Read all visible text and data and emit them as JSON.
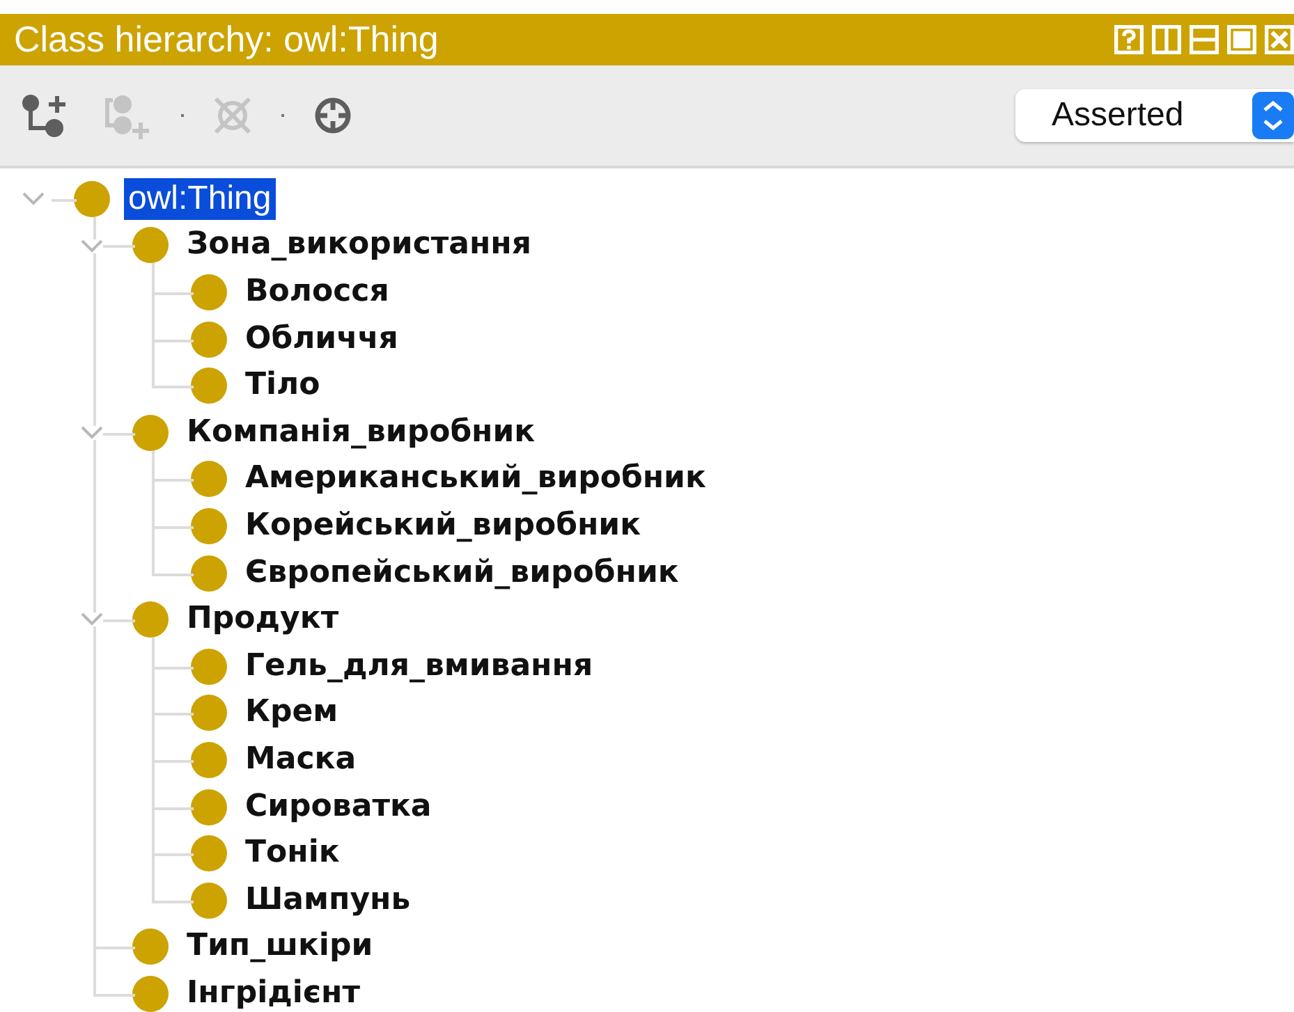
{
  "window": {
    "title": "Class hierarchy: owl:Thing"
  },
  "toolbar": {
    "buttons": [
      {
        "kind": "add-subclass",
        "disabled": false
      },
      {
        "kind": "add-sibling",
        "disabled": true
      },
      {
        "kind": "delete",
        "disabled": true
      },
      {
        "kind": "find",
        "disabled": false
      }
    ]
  },
  "view_mode": {
    "value": "Asserted"
  },
  "tree": [
    {
      "label": "owl:Thing",
      "selected": true,
      "expanded": true,
      "children": [
        {
          "label": "Зона_використання",
          "selected": false,
          "expanded": true,
          "children": [
            {
              "label": "Волосся",
              "selected": false
            },
            {
              "label": "Обличчя",
              "selected": false
            },
            {
              "label": "Тіло",
              "selected": false
            }
          ]
        },
        {
          "label": "Компанія_виробник",
          "selected": false,
          "expanded": true,
          "children": [
            {
              "label": "Американський_виробник",
              "selected": false
            },
            {
              "label": "Корейський_виробник",
              "selected": false
            },
            {
              "label": "Європейський_виробник",
              "selected": false
            }
          ]
        },
        {
          "label": "Продукт",
          "selected": false,
          "expanded": true,
          "children": [
            {
              "label": "Гель_для_вмивання",
              "selected": false
            },
            {
              "label": "Крем",
              "selected": false
            },
            {
              "label": "Маска",
              "selected": false
            },
            {
              "label": "Сироватка",
              "selected": false
            },
            {
              "label": "Тонік",
              "selected": false
            },
            {
              "label": "Шампунь",
              "selected": false
            }
          ]
        },
        {
          "label": "Тип_шкіри",
          "selected": false
        },
        {
          "label": "Інгрідієнт",
          "selected": false
        }
      ]
    }
  ]
}
